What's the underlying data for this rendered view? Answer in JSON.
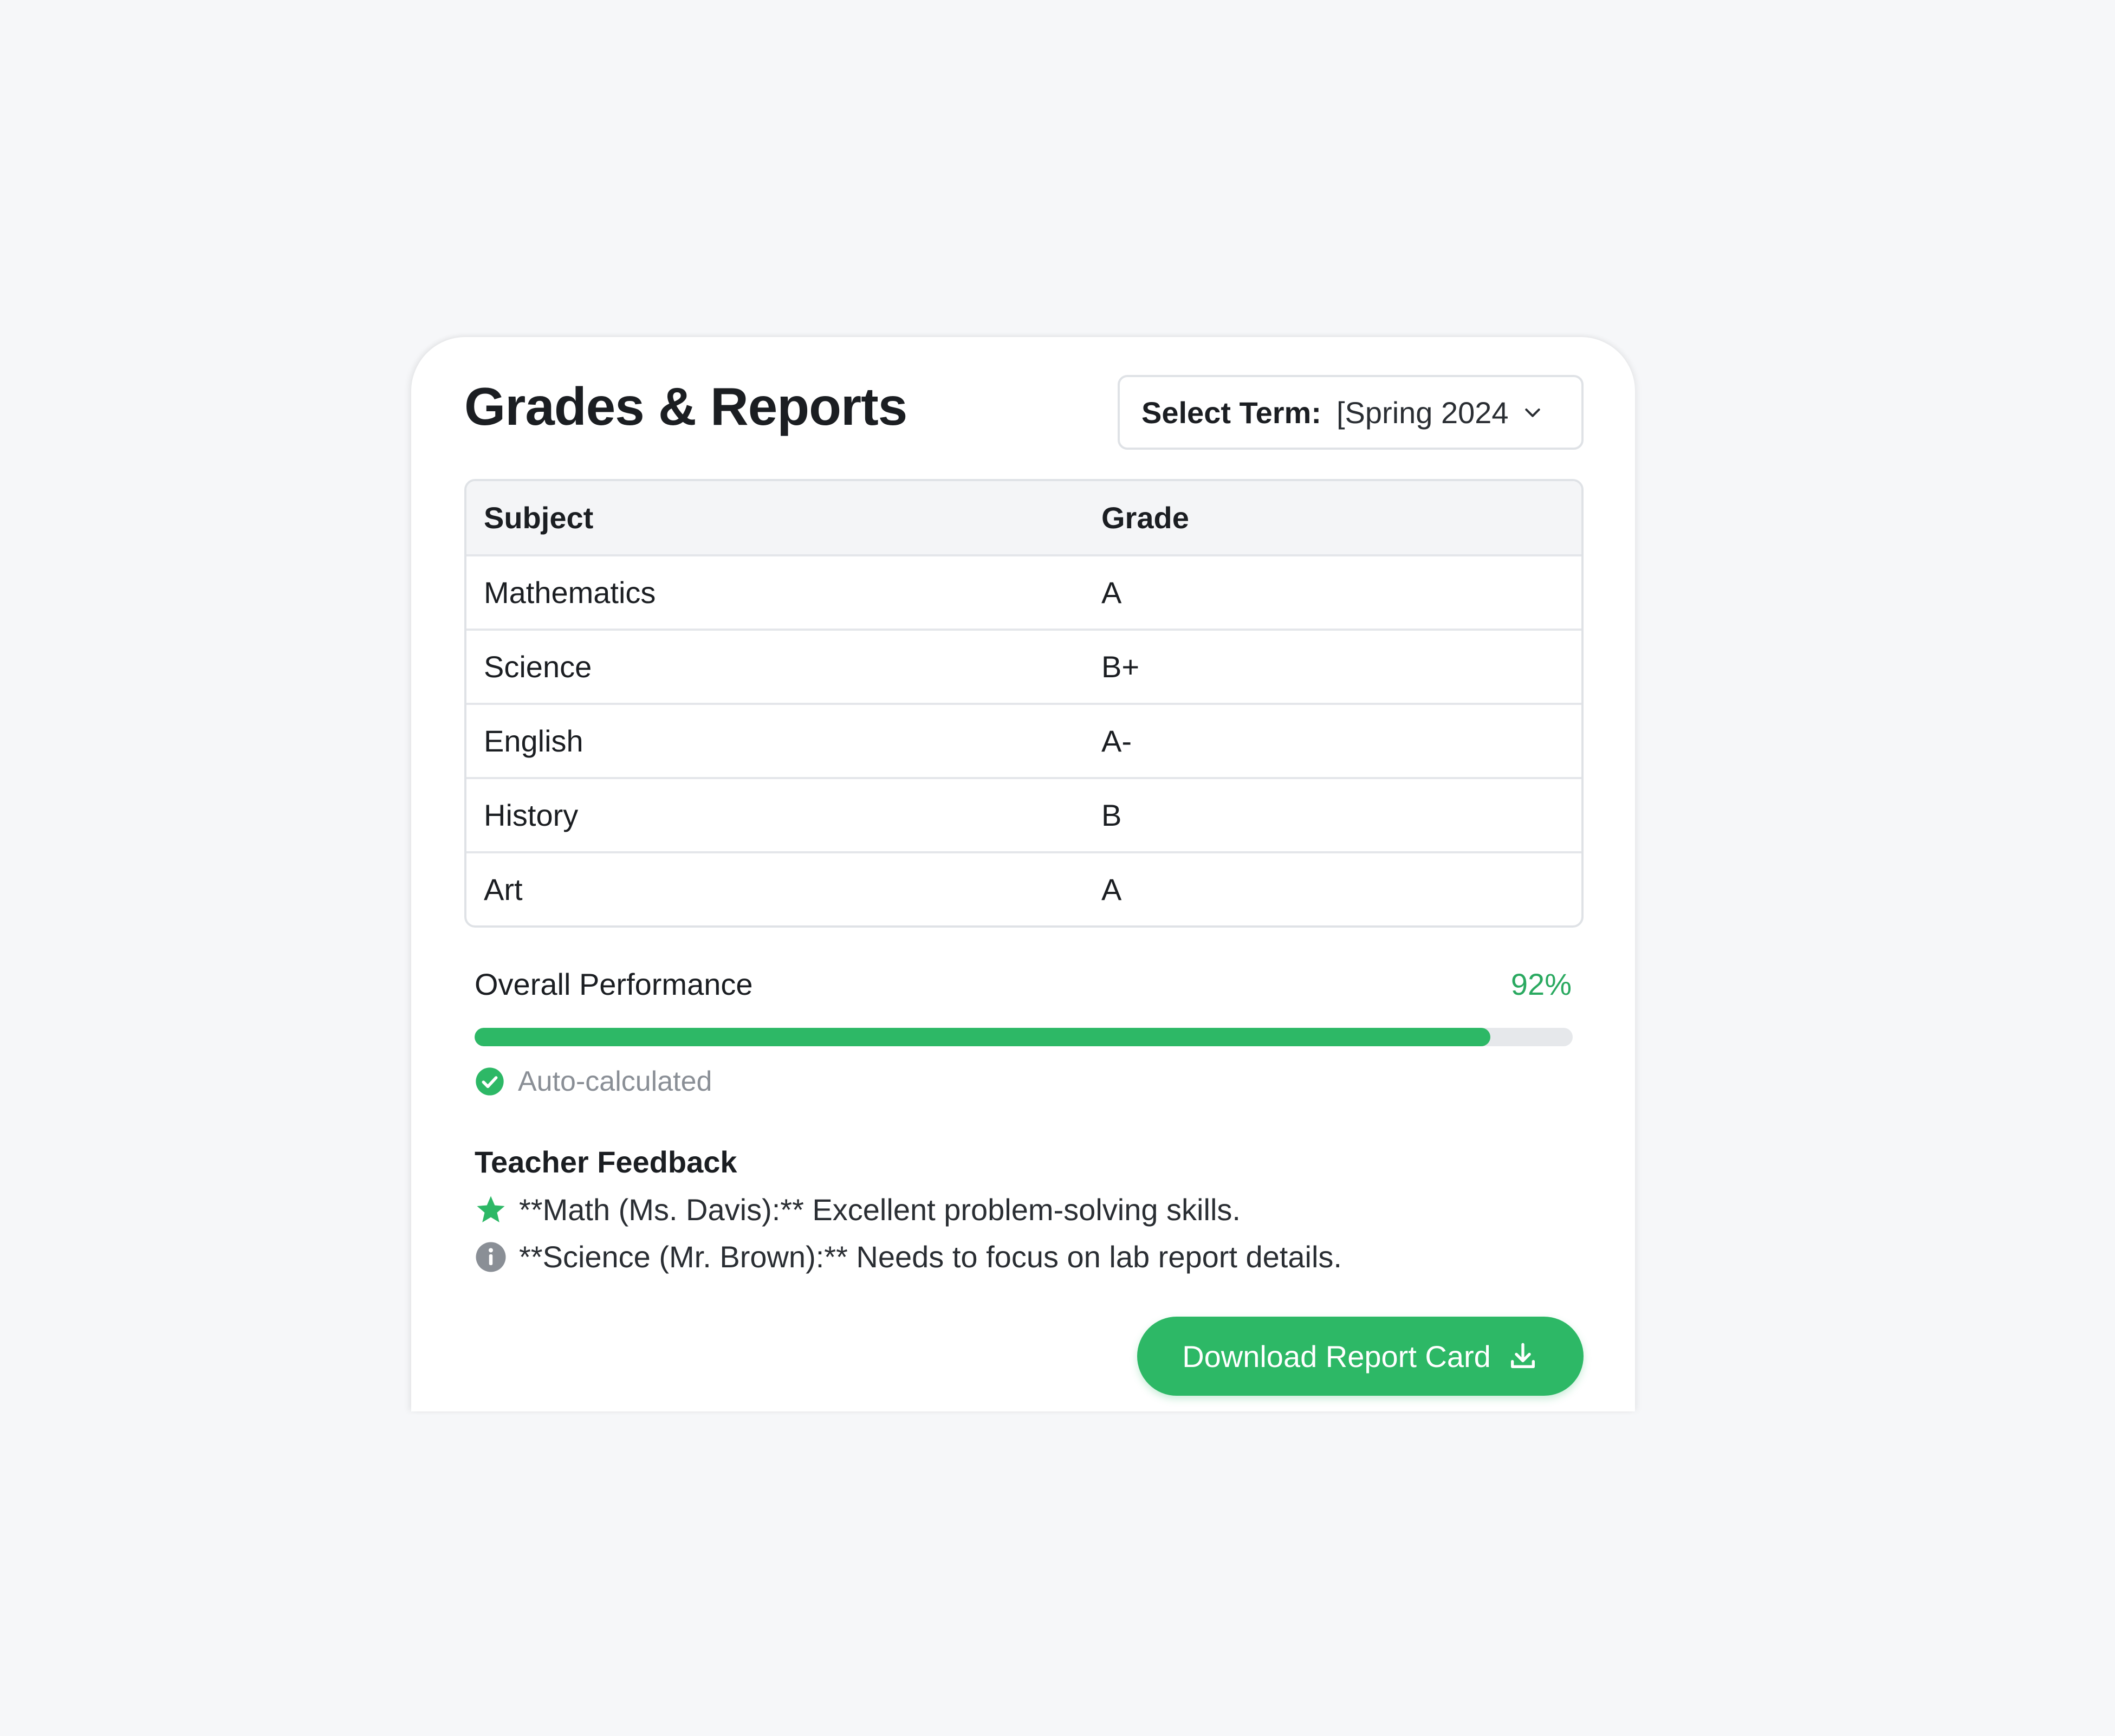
{
  "header": {
    "title": "Grades & Reports",
    "term_select": {
      "label": "Select Term:",
      "value": "[Spring 2024"
    }
  },
  "grades_table": {
    "columns": [
      "Subject",
      "Grade"
    ],
    "rows": [
      {
        "subject": "Mathematics",
        "grade": "A"
      },
      {
        "subject": "Science",
        "grade": "B+"
      },
      {
        "subject": "English",
        "grade": "A-"
      },
      {
        "subject": "History",
        "grade": "B"
      },
      {
        "subject": "Art",
        "grade": "A"
      }
    ]
  },
  "performance": {
    "label": "Overall Performance",
    "value_text": "92%",
    "progress_fraction": 0.925,
    "note": "Auto-calculated"
  },
  "feedback": {
    "title": "Teacher Feedback",
    "items": [
      {
        "icon": "star-icon",
        "text": "**Math (Ms. Davis):** Excellent problem-solving skills."
      },
      {
        "icon": "info-icon",
        "text": "**Science (Mr. Brown):** Needs to focus on lab report details."
      }
    ]
  },
  "actions": {
    "download_label": "Download Report Card",
    "download_icon": "download-icon"
  },
  "colors": {
    "accent": "#2db866",
    "accent_text": "#2aa960",
    "background": "#f6f7f9",
    "card": "#ffffff"
  }
}
